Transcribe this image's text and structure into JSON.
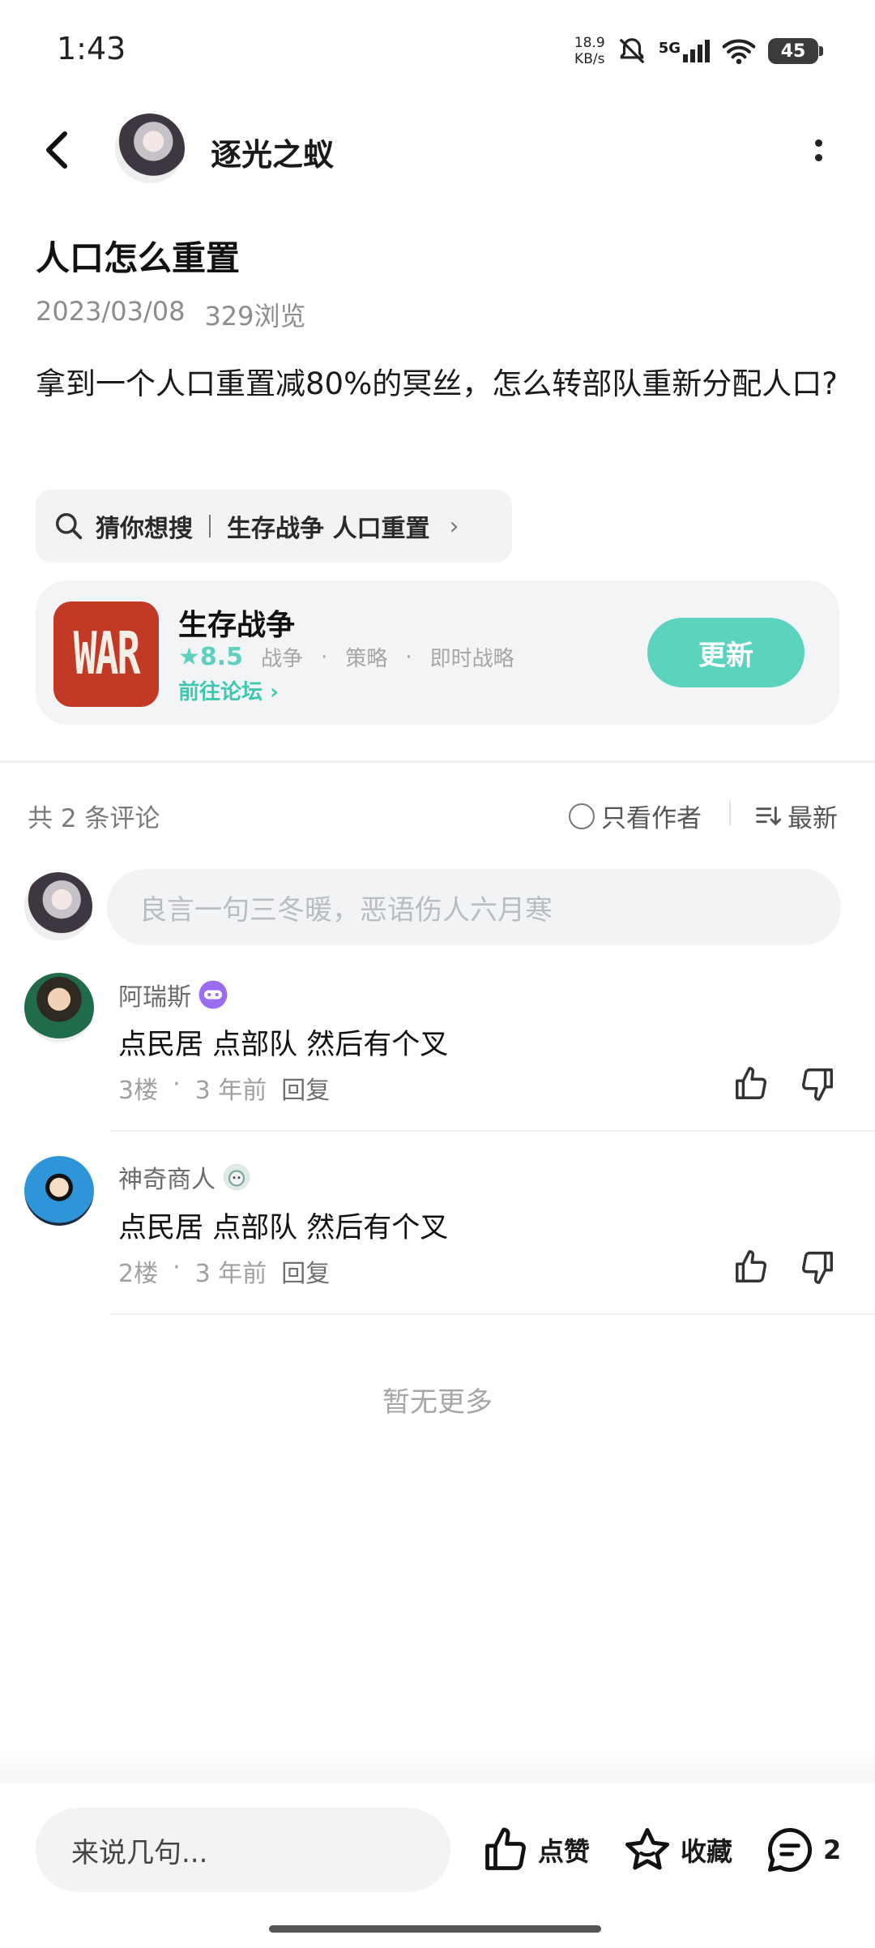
{
  "status_bar": {
    "time": "1:43",
    "net_speed_value": "18.9",
    "net_speed_unit": "KB/s",
    "network": "5G",
    "battery": "45"
  },
  "header": {
    "author_name": "逐光之蚁"
  },
  "post": {
    "title": "人口怎么重置",
    "date": "2023/03/08",
    "views": "329浏览",
    "body": "拿到一个人口重置减80%的冥丝，怎么转部队重新分配人口?"
  },
  "search_suggest": {
    "label": "猜你想搜",
    "query": "生存战争 人口重置"
  },
  "game_card": {
    "icon_text": "WAR",
    "name": "生存战争",
    "rating": "8.5",
    "tags": [
      "战争",
      "策略",
      "即时战略"
    ],
    "forum_link": "前往论坛",
    "update_button": "更新"
  },
  "comments_header": {
    "count_label": "共 2 条评论",
    "author_only": "只看作者",
    "sort": "最新"
  },
  "comment_input": {
    "placeholder": "良言一句三冬暖，恶语伤人六月寒"
  },
  "comments": [
    {
      "name": "阿瑞斯",
      "text": "点民居 点部队 然后有个叉",
      "floor": "3楼",
      "time": "3 年前",
      "reply": "回复"
    },
    {
      "name": "神奇商人",
      "text": "点民居 点部队 然后有个叉",
      "floor": "2楼",
      "time": "3 年前",
      "reply": "回复"
    }
  ],
  "no_more": "暂无更多",
  "bottom_bar": {
    "input_placeholder": "来说几句...",
    "like": "点赞",
    "favorite": "收藏",
    "comment_count": "2"
  },
  "colors": {
    "accent": "#5bd3bf",
    "link": "#3fc8b0",
    "muted": "#a0a0a0",
    "card_bg": "#f3f4f6"
  }
}
